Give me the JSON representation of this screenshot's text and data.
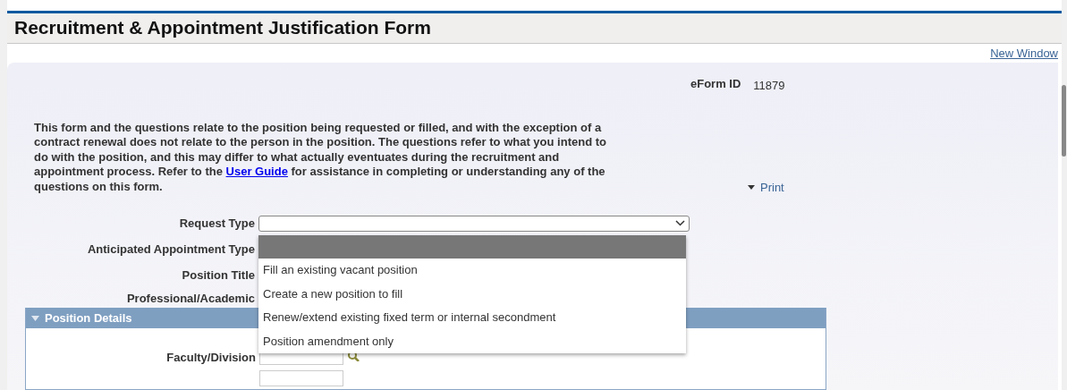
{
  "header": {
    "title": "Recruitment & Appointment Justification Form"
  },
  "toolbar": {
    "new_window_link": "New Window"
  },
  "eform": {
    "label": "eForm ID",
    "value": "11879"
  },
  "intro": {
    "before_link": "This form and the questions relate to the position being requested or filled, and with the exception of a contract renewal does not relate to the person in the position. The questions refer to what you intend to do with the position, and this may differ to what actually eventuates during the recruitment and appointment process. Refer to the ",
    "link": "User Guide",
    "after_link": " for assistance in completing or understanding any of the questions on this form."
  },
  "print_link": "Print",
  "fields": [
    {
      "label": "Request Type",
      "kind": "select"
    },
    {
      "label": "Anticipated Appointment Type",
      "kind": "hidden"
    },
    {
      "label": "Position Title",
      "kind": "hidden"
    },
    {
      "label": "Professional/Academic",
      "kind": "hidden"
    }
  ],
  "request_type_options": [
    {
      "selected": true
    },
    {
      "label": "Fill an existing vacant position",
      "selected": false
    },
    {
      "label": "Create a new position to fill",
      "selected": false
    },
    {
      "label": "Renew/extend existing fixed term or internal secondment",
      "selected": false
    },
    {
      "label": "Position amendment only",
      "selected": false
    }
  ],
  "section": {
    "title": "Position Details",
    "expanded": true,
    "fields": [
      {
        "label": "Faculty/Division",
        "kind": "lookup"
      },
      {
        "kind": "text"
      }
    ]
  }
}
